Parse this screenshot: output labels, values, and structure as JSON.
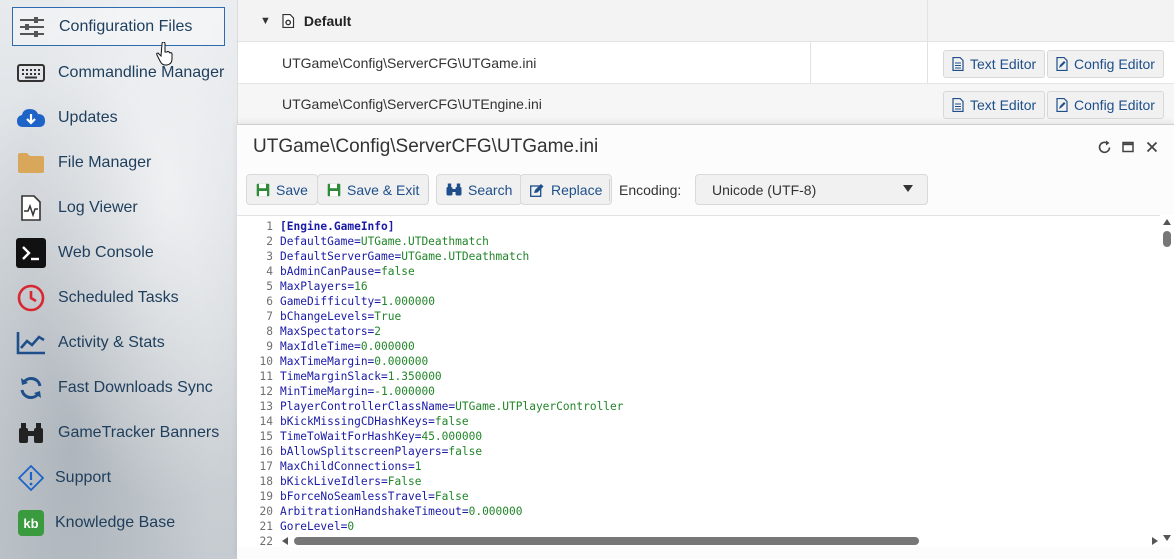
{
  "sidebar": {
    "items": [
      {
        "label": "Configuration Files",
        "icon": "sliders-icon"
      },
      {
        "label": "Commandline Manager",
        "icon": "keyboard-icon"
      },
      {
        "label": "Updates",
        "icon": "cloud-download-icon"
      },
      {
        "label": "File Manager",
        "icon": "folder-icon"
      },
      {
        "label": "Log Viewer",
        "icon": "log-file-icon"
      },
      {
        "label": "Web Console",
        "icon": "terminal-icon"
      },
      {
        "label": "Scheduled Tasks",
        "icon": "clock-icon"
      },
      {
        "label": "Activity & Stats",
        "icon": "chart-line-icon"
      },
      {
        "label": "Fast Downloads Sync",
        "icon": "sync-icon"
      },
      {
        "label": "GameTracker Banners",
        "icon": "binoculars-icon"
      },
      {
        "label": "Support",
        "icon": "support-icon"
      },
      {
        "label": "Knowledge Base",
        "icon": "kb-icon"
      }
    ],
    "active_index": 0
  },
  "file_table": {
    "group_title": "Default",
    "rows": [
      {
        "path": "UTGame\\Config\\ServerCFG\\UTGame.ini",
        "text_editor": "Text Editor",
        "config_editor": "Config Editor"
      },
      {
        "path": "UTGame\\Config\\ServerCFG\\UTEngine.ini",
        "text_editor": "Text Editor",
        "config_editor": "Config Editor"
      }
    ]
  },
  "editor": {
    "title": "UTGame\\Config\\ServerCFG\\UTGame.ini",
    "toolbar": {
      "save": "Save",
      "save_exit": "Save & Exit",
      "search": "Search",
      "replace": "Replace",
      "encoding_label": "Encoding:",
      "encoding_value": "Unicode (UTF-8)"
    },
    "lines": [
      {
        "n": "1",
        "key": "[Engine.GameInfo]",
        "val": ""
      },
      {
        "n": "2",
        "key": "DefaultGame=",
        "val": "UTGame.UTDeathmatch"
      },
      {
        "n": "3",
        "key": "DefaultServerGame=",
        "val": "UTGame.UTDeathmatch"
      },
      {
        "n": "4",
        "key": "bAdminCanPause=",
        "val": "false"
      },
      {
        "n": "5",
        "key": "MaxPlayers=",
        "val": "16"
      },
      {
        "n": "6",
        "key": "GameDifficulty=",
        "val": "1.000000"
      },
      {
        "n": "7",
        "key": "bChangeLevels=",
        "val": "True"
      },
      {
        "n": "8",
        "key": "MaxSpectators=",
        "val": "2"
      },
      {
        "n": "9",
        "key": "MaxIdleTime=",
        "val": "0.000000"
      },
      {
        "n": "10",
        "key": "MaxTimeMargin=",
        "val": "0.000000"
      },
      {
        "n": "11",
        "key": "TimeMarginSlack=",
        "val": "1.350000"
      },
      {
        "n": "12",
        "key": "MinTimeMargin=",
        "val": "-1.000000"
      },
      {
        "n": "13",
        "key": "PlayerControllerClassName=",
        "val": "UTGame.UTPlayerController"
      },
      {
        "n": "14",
        "key": "bKickMissingCDHashKeys=",
        "val": "false"
      },
      {
        "n": "15",
        "key": "TimeToWaitForHashKey=",
        "val": "45.000000"
      },
      {
        "n": "16",
        "key": "bAllowSplitscreenPlayers=",
        "val": "false"
      },
      {
        "n": "17",
        "key": "MaxChildConnections=",
        "val": "1"
      },
      {
        "n": "18",
        "key": "bKickLiveIdlers=",
        "val": "False"
      },
      {
        "n": "19",
        "key": "bForceNoSeamlessTravel=",
        "val": "False"
      },
      {
        "n": "20",
        "key": "ArbitrationHandshakeTimeout=",
        "val": "0.000000"
      },
      {
        "n": "21",
        "key": "GoreLevel=",
        "val": "0"
      },
      {
        "n": "22",
        "key": "",
        "val": ""
      }
    ]
  },
  "colors": {
    "accent": "#1e4f8a",
    "key_text": "#1a1aa6",
    "value_text": "#22862a",
    "active_border": "#2e6ab0"
  }
}
